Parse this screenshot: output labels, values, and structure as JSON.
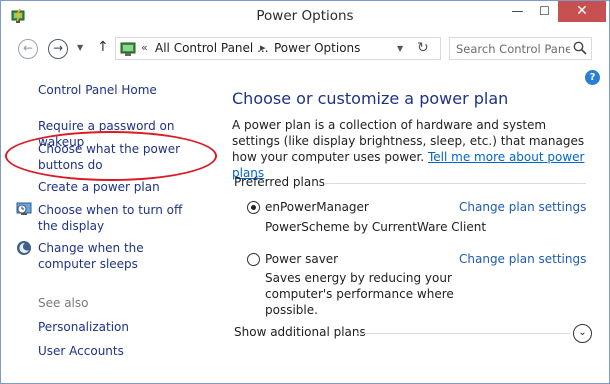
{
  "window": {
    "title": "Power Options",
    "minimize_glyph": "—",
    "maximize_glyph": "☐",
    "close_glyph": "✕"
  },
  "address_bar": {
    "breadcrumb_sep": "«",
    "crumbs": [
      "All Control Panel ...",
      "Power Options"
    ],
    "crumb_arrow": "▸",
    "search_placeholder": "Search Control Panel"
  },
  "sidebar": {
    "home_link": "Control Panel Home",
    "links": [
      "Require a password on wakeup",
      "Choose what the power buttons do",
      "Create a power plan",
      "Choose when to turn off the display",
      "Change when the computer sleeps"
    ],
    "see_also_label": "See also",
    "see_also_links": [
      "Personalization",
      "User Accounts"
    ]
  },
  "main": {
    "heading": "Choose or customize a power plan",
    "description": "A power plan is a collection of hardware and system settings (like display brightness, sleep, etc.) that manages how your computer uses power.",
    "description_link": "Tell me more about power plans",
    "preferred_plans_label": "Preferred plans",
    "plans": [
      {
        "name": "enPowerManager",
        "selected": true,
        "description": "PowerScheme by CurrentWare Client",
        "link": "Change plan settings"
      },
      {
        "name": "Power saver",
        "selected": false,
        "description": "Saves energy by reducing your computer's performance where possible.",
        "link": "Change plan settings"
      }
    ],
    "additional_plans_label": "Show additional plans"
  },
  "colors": {
    "link": "#1e3287",
    "highlight": "#d81b24",
    "close_button": "#c75050"
  }
}
